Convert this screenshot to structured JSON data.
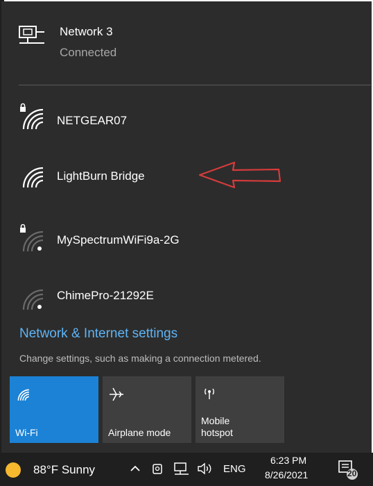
{
  "networks": [
    {
      "name": "Network 3",
      "status": "Connected",
      "icon": "ethernet-icon"
    },
    {
      "name": "NETGEAR07",
      "icon": "wifi-secured-icon"
    },
    {
      "name": "LightBurn Bridge",
      "icon": "wifi-icon"
    },
    {
      "name": "MySpectrumWiFi9a-2G",
      "icon": "wifi-secured-weak-icon"
    },
    {
      "name": "ChimePro-21292E",
      "icon": "wifi-weak-icon"
    }
  ],
  "settings": {
    "link_label": "Network & Internet settings",
    "description": "Change settings, such as making a connection metered."
  },
  "quick_actions": [
    {
      "label": "Wi-Fi",
      "icon": "wifi-icon",
      "active": true
    },
    {
      "label": "Airplane mode",
      "icon": "airplane-icon",
      "active": false
    },
    {
      "label_line1": "Mobile",
      "label_line2": "hotspot",
      "icon": "hotspot-icon",
      "active": false
    }
  ],
  "taskbar": {
    "weather": "88°F  Sunny",
    "language": "ENG",
    "time": "6:23 PM",
    "date": "8/26/2021",
    "notification_count": "20"
  },
  "colors": {
    "panel_bg": "#2c2c2c",
    "accent": "#1b82d6",
    "link": "#5fb4f5",
    "annotation_arrow": "#d63b3b"
  }
}
